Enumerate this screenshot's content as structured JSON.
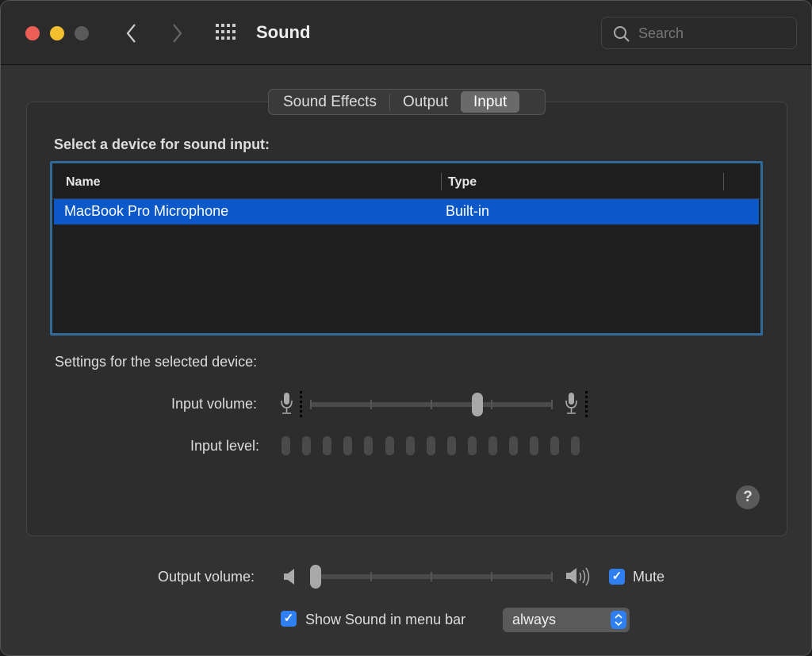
{
  "window": {
    "title": "Sound",
    "traffic_lights": {
      "close": "#ec5f57",
      "minimize": "#f4bf2f",
      "zoom": "#5a5a5a"
    }
  },
  "toolbar": {
    "back_icon": "chevron-left",
    "forward_icon": "chevron-right",
    "grid_icon": "grid",
    "search": {
      "placeholder": "Search"
    }
  },
  "tabs": [
    {
      "label": "Sound Effects"
    },
    {
      "label": "Output"
    },
    {
      "label": "Input",
      "selected": true
    }
  ],
  "input": {
    "heading": "Select a device for sound input:",
    "columns": [
      "Name",
      "Type"
    ],
    "rows": [
      {
        "name": "MacBook Pro Microphone",
        "type": "Built-in",
        "selected": true
      }
    ],
    "settings_label": "Settings for the selected device:",
    "input_volume_label": "Input volume:",
    "input_volume_percent": 70,
    "input_level_label": "Input level:",
    "input_level_segments": 15,
    "input_level_active": 0
  },
  "footer": {
    "output_volume_label": "Output volume:",
    "output_volume_percent": 0,
    "mute_label": "Mute",
    "mute_checked": true,
    "show_menu_label": "Show Sound in menu bar",
    "show_menu_checked": true,
    "menu_select_value": "always"
  },
  "accent": "#0a58ca"
}
